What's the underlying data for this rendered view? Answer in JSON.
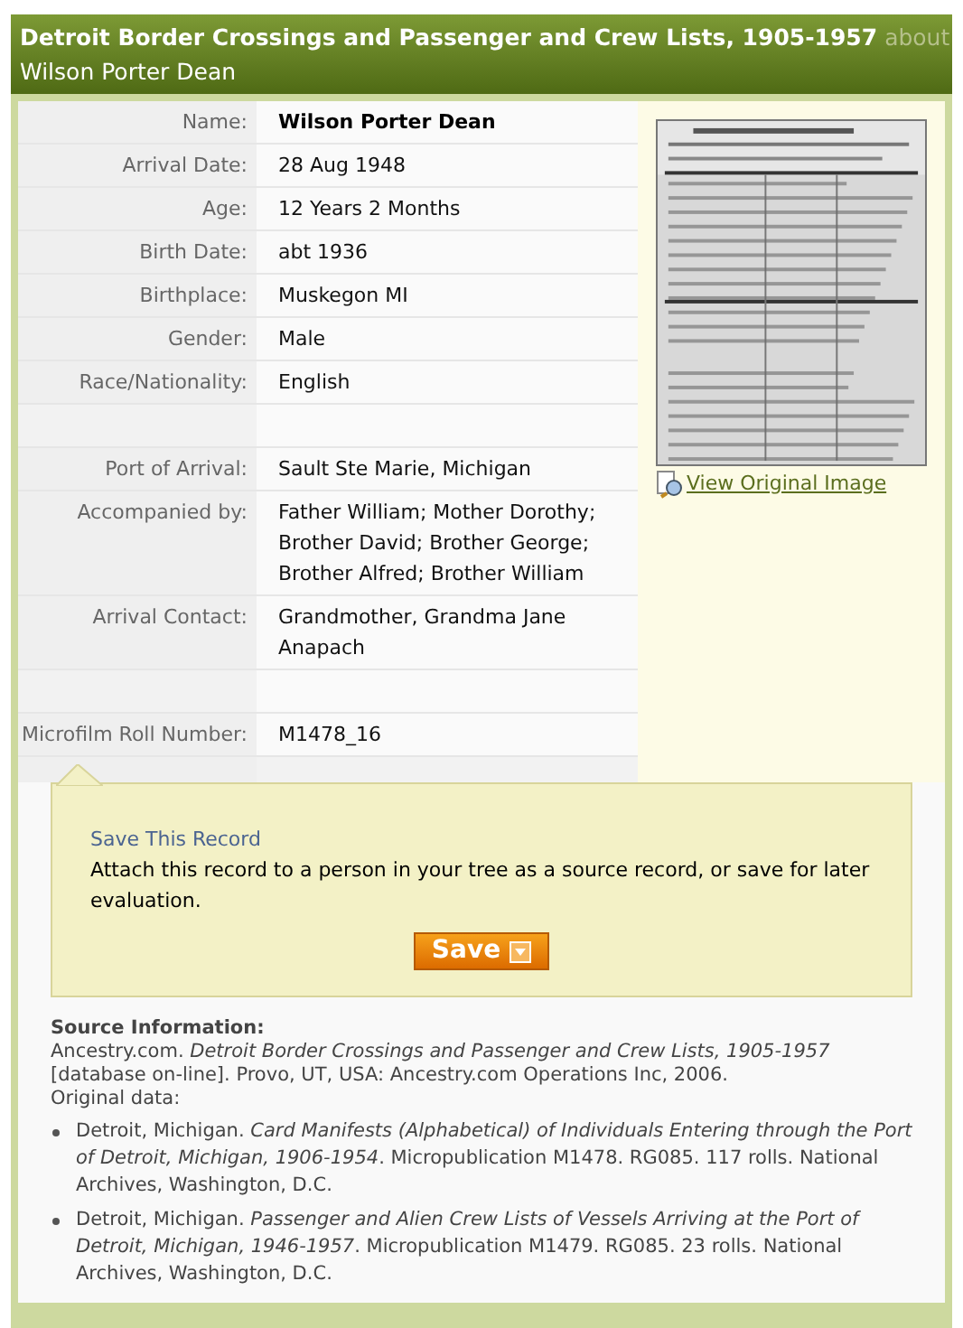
{
  "header": {
    "title": "Detroit Border Crossings and Passenger and Crew Lists, 1905-1957",
    "about": "about",
    "subject": "Wilson Porter Dean"
  },
  "fields": [
    {
      "kind": "field",
      "label": "Name:",
      "value": "Wilson Porter Dean",
      "bold": true
    },
    {
      "kind": "field",
      "label": "Arrival Date:",
      "value": "28 Aug 1948",
      "bold": false
    },
    {
      "kind": "field",
      "label": "Age:",
      "value": "12 Years 2 Months",
      "bold": false
    },
    {
      "kind": "field",
      "label": "Birth Date:",
      "value": "abt 1936",
      "bold": false
    },
    {
      "kind": "field",
      "label": "Birthplace:",
      "value": "Muskegon MI",
      "bold": false
    },
    {
      "kind": "field",
      "label": "Gender:",
      "value": "Male",
      "bold": false
    },
    {
      "kind": "field",
      "label": "Race/Nationality:",
      "value": "English",
      "bold": false
    },
    {
      "kind": "spacer"
    },
    {
      "kind": "field",
      "label": "Port of Arrival:",
      "value": "Sault Ste Marie, Michigan",
      "bold": false
    },
    {
      "kind": "field",
      "label": "Accompanied by:",
      "value": "Father William; Mother Dorothy; Brother David; Brother George; Brother Alfred; Brother William",
      "bold": false
    },
    {
      "kind": "field",
      "label": "Arrival Contact:",
      "value": "Grandmother, Grandma Jane Anapach",
      "bold": false
    },
    {
      "kind": "spacer"
    },
    {
      "kind": "field",
      "label": "Microfilm Roll Number:",
      "value": "M1478_16",
      "bold": false
    }
  ],
  "image": {
    "kind": "picture",
    "link": "View Original Image"
  },
  "save": {
    "title": "Save This Record",
    "text": "Attach this record to a person in your tree as a source record, or save for later evaluation.",
    "button": "Save"
  },
  "source": {
    "heading": "Source Information:",
    "citation": "Ancestry.com. *Detroit Border Crossings and Passenger and Crew Lists, 1905-1957* [database on-line]. Provo, UT, USA: Ancestry.com Operations Inc, 2006.",
    "original_label": "Original data:",
    "items": [
      "Detroit, Michigan. *Card Manifests (Alphabetical) of Individuals Entering through the Port of Detroit, Michigan, 1906-1954*. Micropublication M1478. RG085. 117 rolls. National Archives, Washington, D.C.",
      "Detroit, Michigan. *Passenger and Alien Crew Lists of Vessels Arriving at the Port of Detroit, Michigan, 1946-1957*. Micropublication M1479. RG085. 23 rolls. National Archives, Washington, D.C."
    ]
  }
}
